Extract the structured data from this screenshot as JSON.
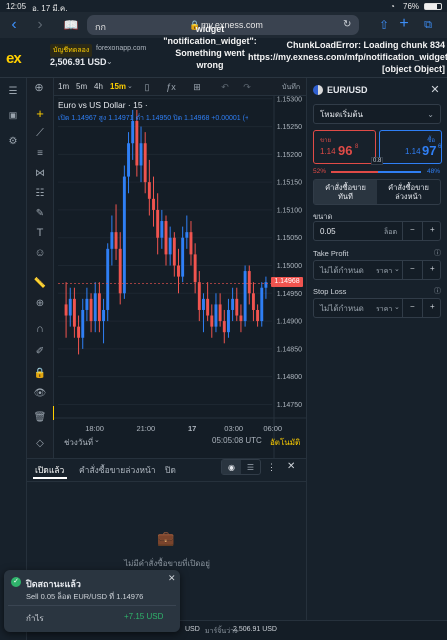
{
  "status": {
    "time": "12:05",
    "date": "อ. 17 มี.ค.",
    "battery": "76%"
  },
  "browser": {
    "tab_label": "กก",
    "url": "my.exness.com"
  },
  "account": {
    "type": "บัญชีทดลอง",
    "site": "forexonapp.com",
    "balance": "2,506.91 USD"
  },
  "error_overlay": {
    "left": "widget\n\"notification_widget\":\nSomething went\nwrong",
    "right": "ChunkLoadError: Loading chunk 834\nhttps://my.exness.com/mfp/notification_widget\n[object Object]"
  },
  "timeframes": [
    "1m",
    "5m",
    "4h",
    "15m"
  ],
  "timeframe_active": "15m",
  "save_label": "บันทึก",
  "chart_info": {
    "title": "Euro vs US Dollar · 15 ·",
    "ohlc": "เปิด 1.14967 สูง 1.14971 ต่ำ 1.14950 ปิด 1.14968 +0.00001 (+",
    "current_price": "1.14968",
    "time_display": "05:05:08 UTC",
    "auto_label": "อัตโนมัติ",
    "range_label": "ช่วงวันที่"
  },
  "chart_data": {
    "type": "candlestick",
    "title": "Euro vs US Dollar · 15",
    "x_ticks": [
      "18:00",
      "21:00",
      "17",
      "03:00",
      "06:00"
    ],
    "y_ticks": [
      "1.15300",
      "1.15250",
      "1.15200",
      "1.15150",
      "1.15100",
      "1.15050",
      "1.15000",
      "1.14950",
      "1.14900",
      "1.14850",
      "1.14800",
      "1.14750"
    ],
    "ylim": [
      1.1474,
      1.15305
    ],
    "up_color": "#2f7ff5",
    "down_color": "#f0544f",
    "candles": [
      [
        1.1493,
        1.1497,
        1.1487,
        1.1491
      ],
      [
        1.1491,
        1.1496,
        1.1489,
        1.1494
      ],
      [
        1.1494,
        1.1496,
        1.1487,
        1.1489
      ],
      [
        1.1489,
        1.1491,
        1.1484,
        1.1487
      ],
      [
        1.1487,
        1.1494,
        1.1485,
        1.1492
      ],
      [
        1.1492,
        1.1496,
        1.149,
        1.1494
      ],
      [
        1.1494,
        1.1495,
        1.1488,
        1.149
      ],
      [
        1.149,
        1.1497,
        1.1488,
        1.1495
      ],
      [
        1.1495,
        1.1497,
        1.1488,
        1.149
      ],
      [
        1.149,
        1.1494,
        1.1486,
        1.1492
      ],
      [
        1.1492,
        1.1504,
        1.149,
        1.1503
      ],
      [
        1.1503,
        1.1509,
        1.15,
        1.1506
      ],
      [
        1.1506,
        1.1511,
        1.1501,
        1.1503
      ],
      [
        1.1503,
        1.1506,
        1.1493,
        1.1495
      ],
      [
        1.1495,
        1.1518,
        1.1494,
        1.1516
      ],
      [
        1.1516,
        1.1524,
        1.1513,
        1.1522
      ],
      [
        1.1522,
        1.1528,
        1.1519,
        1.1526
      ],
      [
        1.1526,
        1.1528,
        1.1516,
        1.1518
      ],
      [
        1.1518,
        1.1525,
        1.1515,
        1.1522
      ],
      [
        1.1522,
        1.1524,
        1.1513,
        1.1515
      ],
      [
        1.1515,
        1.1519,
        1.1509,
        1.1512
      ],
      [
        1.1512,
        1.1516,
        1.1507,
        1.151
      ],
      [
        1.151,
        1.1513,
        1.1502,
        1.1505
      ],
      [
        1.1505,
        1.151,
        1.1503,
        1.1508
      ],
      [
        1.1508,
        1.1509,
        1.15,
        1.1502
      ],
      [
        1.1502,
        1.1507,
        1.15,
        1.1505
      ],
      [
        1.1505,
        1.1506,
        1.1498,
        1.15
      ],
      [
        1.15,
        1.1503,
        1.1495,
        1.1498
      ],
      [
        1.1498,
        1.1507,
        1.1497,
        1.1505
      ],
      [
        1.1505,
        1.1509,
        1.1503,
        1.1506
      ],
      [
        1.1506,
        1.1508,
        1.15,
        1.1502
      ],
      [
        1.1502,
        1.1504,
        1.1495,
        1.1497
      ],
      [
        1.1497,
        1.1499,
        1.149,
        1.1492
      ],
      [
        1.1492,
        1.1495,
        1.1488,
        1.1494
      ],
      [
        1.1494,
        1.1497,
        1.149,
        1.1491
      ],
      [
        1.1491,
        1.1493,
        1.1487,
        1.1489
      ],
      [
        1.1489,
        1.1495,
        1.1488,
        1.1493
      ],
      [
        1.1493,
        1.1495,
        1.1489,
        1.149
      ],
      [
        1.149,
        1.1492,
        1.1486,
        1.1488
      ],
      [
        1.1488,
        1.1494,
        1.1487,
        1.1492
      ],
      [
        1.1492,
        1.1496,
        1.149,
        1.1494
      ],
      [
        1.1494,
        1.1496,
        1.149,
        1.1491
      ],
      [
        1.1491,
        1.1493,
        1.1488,
        1.149
      ],
      [
        1.149,
        1.15,
        1.1489,
        1.1499
      ],
      [
        1.1499,
        1.15,
        1.1493,
        1.1495
      ],
      [
        1.1495,
        1.1497,
        1.149,
        1.1492
      ],
      [
        1.1492,
        1.1493,
        1.1489,
        1.149
      ],
      [
        1.149,
        1.1497,
        1.1489,
        1.1496
      ],
      [
        1.1496,
        1.1498,
        1.1494,
        1.1497
      ]
    ]
  },
  "order_panel": {
    "symbol": "EUR/USD",
    "mode": "โหมดเริ่มต้น",
    "sell_label": "ขาย",
    "sell_price_prefix": "1.14",
    "sell_price_big": "96",
    "sell_price_sup": "8",
    "buy_label": "ซื้อ",
    "buy_price_prefix": "1.14",
    "buy_price_big": "97",
    "buy_price_sup": "6",
    "spread": "0.8",
    "sell_pct": "52%",
    "buy_pct": "48%",
    "tab_market": "คำสั่งซื้อขาย\nทันที",
    "tab_pending": "คำสั่งซื้อขาย\nล่วงหน้า",
    "volume_label": "ขนาด",
    "volume_value": "0.05",
    "volume_unit": "ล็อต",
    "tp_label": "Take Profit",
    "tp_value": "ไม่ได้กำหนด",
    "tp_unit": "ราคา",
    "sl_label": "Stop Loss",
    "sl_value": "ไม่ได้กำหนด",
    "sl_unit": "ราคา"
  },
  "bottom_tabs": [
    "เปิดแล้ว",
    "คำสั่งซื้อขายล่วงหน้า",
    "ปิด"
  ],
  "empty_text": "ไม่มีคำสั่งซื้อขายที่เปิดอยู่",
  "footer": {
    "left": "USD",
    "margin_label": "มาร์จิ้นว่าง",
    "margin_value": "2,506.91 USD"
  },
  "toast": {
    "title": "ปิดสถานะแล้ว",
    "message": "Sell 0.05 ล็อต EUR/USD ที่ 1.14976",
    "profit_label": "กำไร",
    "profit_value": "+7.15 USD"
  }
}
